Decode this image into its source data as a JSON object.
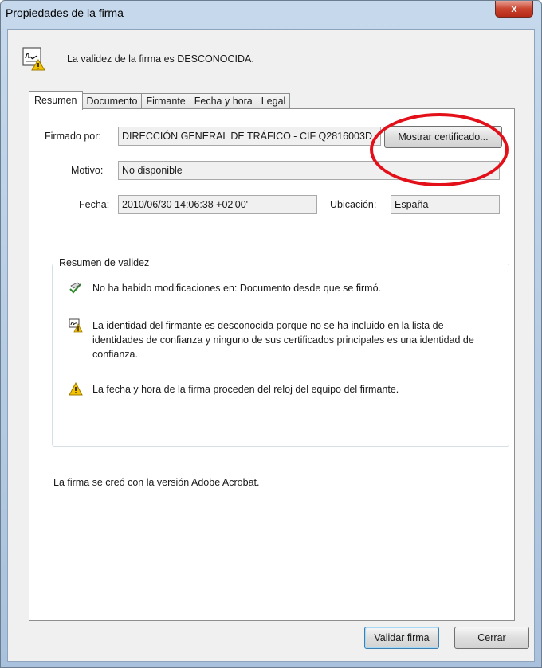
{
  "window": {
    "title": "Propiedades de la firma",
    "close_label": "x"
  },
  "header": {
    "status_text": "La validez de la firma es DESCONOCIDA."
  },
  "tabs": [
    "Resumen",
    "Documento",
    "Firmante",
    "Fecha y hora",
    "Legal"
  ],
  "summary": {
    "signed_by_label": "Firmado por:",
    "signed_by_value": "DIRECCIÓN GENERAL DE TRÁFICO - CIF Q2816003D",
    "show_cert_button": "Mostrar certificado...",
    "reason_label": "Motivo:",
    "reason_value": "No disponible",
    "date_label": "Fecha:",
    "date_value": "2010/06/30 14:06:38 +02'00'",
    "location_label": "Ubicación:",
    "location_value": "España"
  },
  "validity": {
    "title": "Resumen de validez",
    "items": [
      {
        "icon": "pen-check-icon",
        "text": "No ha habido modificaciones en: Documento desde que se firmó."
      },
      {
        "icon": "warning-certificate-icon",
        "text": "La identidad del firmante es desconocida porque no se ha incluido en la lista de identidades de confianza y ninguno de sus certificados principales es una identidad de confianza."
      },
      {
        "icon": "warning-icon",
        "text": "La fecha y hora de la firma proceden del reloj del equipo del firmante."
      }
    ]
  },
  "footer_text": "La firma se creó con la versión Adobe Acrobat.",
  "buttons": {
    "validate": "Validar firma",
    "close": "Cerrar"
  },
  "colors": {
    "highlight_circle": "#e3101a",
    "close_button": "#c9442e",
    "warning": "#f2c200"
  }
}
